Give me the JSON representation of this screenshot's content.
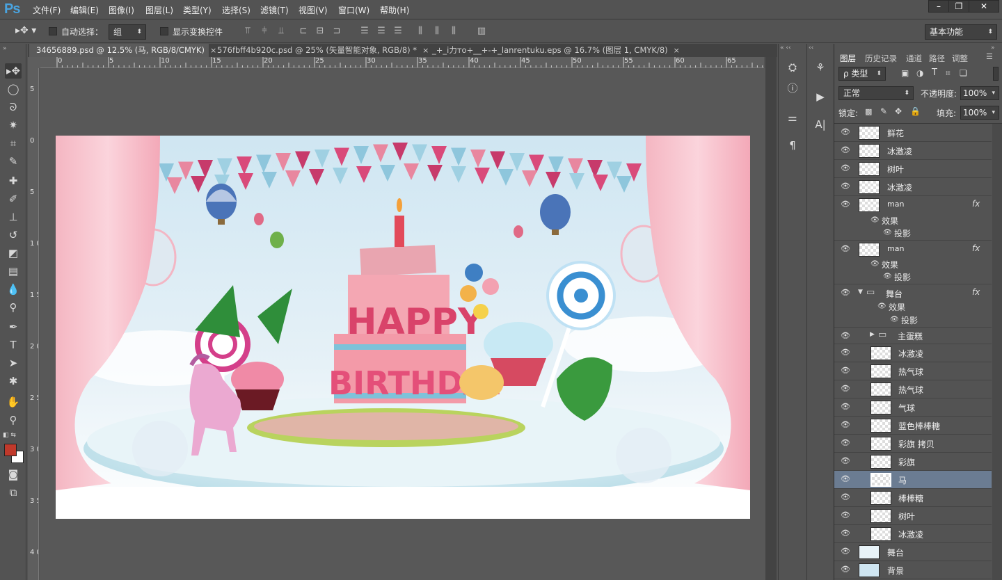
{
  "app": {
    "logo": "Ps"
  },
  "menu": [
    "文件(F)",
    "编辑(E)",
    "图像(I)",
    "图层(L)",
    "类型(Y)",
    "选择(S)",
    "滤镜(T)",
    "视图(V)",
    "窗口(W)",
    "帮助(H)"
  ],
  "window_controls": {
    "minimize": "–",
    "restore": "❐",
    "close": "✕"
  },
  "options": {
    "auto_select_label": "自动选择：",
    "auto_select_value": "组",
    "show_transform_label": "显示变换控件",
    "workspace": "基本功能"
  },
  "tabs": [
    {
      "label": "34656889.psd @ 12.5% (马, RGB/8/CMYK)",
      "close": "×"
    },
    {
      "label": "576fbff4b920c.psd @ 25% (矢量智能对象, RGB/8) *",
      "close": "×"
    },
    {
      "label": "_+_i力ᴛo+__+-+_lanrentuku.eps @ 16.7% (图层 1, CMYK/8)",
      "close": "×"
    }
  ],
  "ruler_top": [
    "0",
    "5",
    "10",
    "15",
    "20",
    "25",
    "30",
    "35",
    "40",
    "45",
    "50",
    "55",
    "60",
    "65"
  ],
  "ruler_left": [
    "5",
    "0",
    "5",
    "1 0",
    "1 5",
    "2 0",
    "2 5",
    "3 0",
    "3 5",
    "4 0"
  ],
  "canvas": {
    "banner_line1": "HAPPY",
    "banner_line2": "BIRTHDAY"
  },
  "panel": {
    "tabs": [
      "图层",
      "历史记录",
      "通道",
      "路径",
      "调整"
    ],
    "filter_type": "ρ 类型",
    "blend_mode": "正常",
    "opacity_label": "不透明度:",
    "opacity_value": "100%",
    "lock_label": "锁定:",
    "fill_label": "填充:",
    "fill_value": "100%"
  },
  "layers": [
    {
      "name": "鲜花"
    },
    {
      "name": "冰激凌"
    },
    {
      "name": "树叶"
    },
    {
      "name": "冰激凌"
    },
    {
      "name": "man",
      "fx": "fx",
      "effects": "效果",
      "shadow": "投影"
    },
    {
      "name": "man",
      "fx": "fx",
      "effects": "效果",
      "shadow": "投影"
    },
    {
      "name": "舞台",
      "fx": "fx",
      "effects": "效果",
      "shadow": "投影"
    },
    {
      "name": "主蛋糕"
    },
    {
      "name": "冰激凌"
    },
    {
      "name": "热气球"
    },
    {
      "name": "热气球"
    },
    {
      "name": "气球"
    },
    {
      "name": "蓝色棒棒糖"
    },
    {
      "name": "彩旗 拷贝"
    },
    {
      "name": "彩旗"
    },
    {
      "name": "马"
    },
    {
      "name": "棒棒糖"
    },
    {
      "name": "树叶"
    },
    {
      "name": "冰激凌"
    },
    {
      "name": "舞台"
    },
    {
      "name": "背景"
    }
  ]
}
